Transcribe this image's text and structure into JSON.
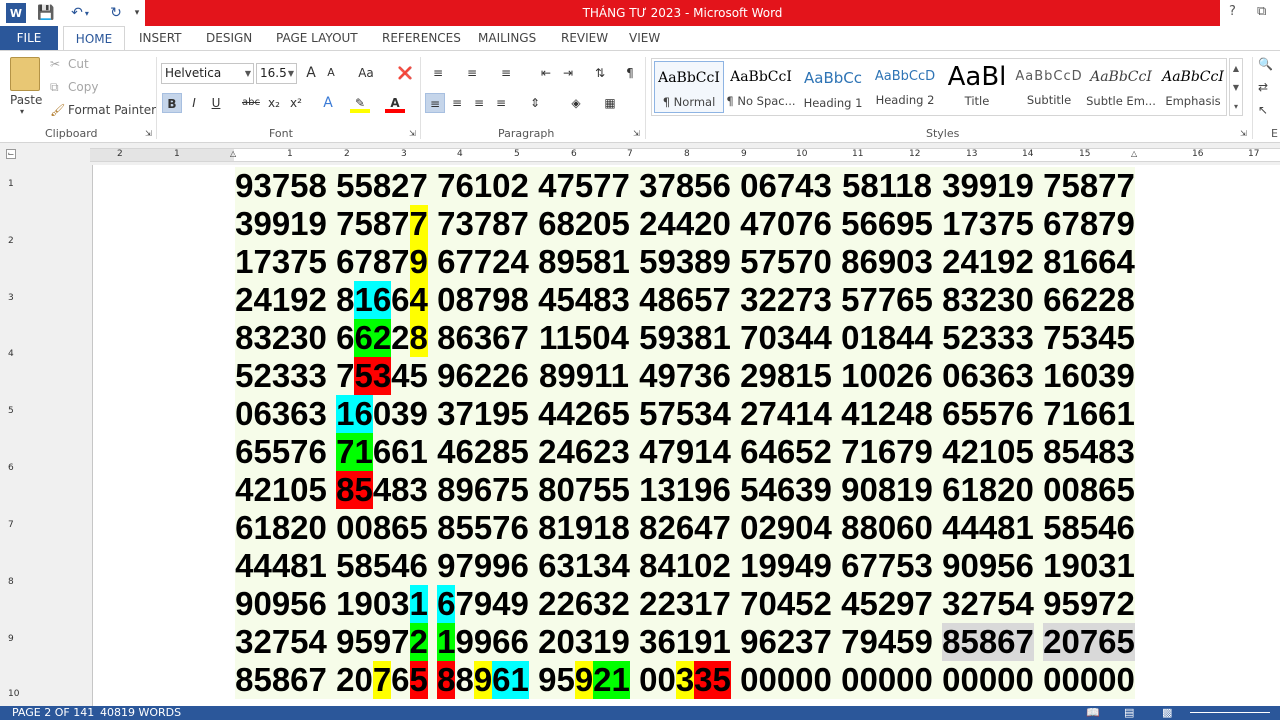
{
  "title": "THÁNG TƯ 2023 -  Microsoft Word",
  "titlebar_right": {
    "help": "?",
    "restore": "⧉"
  },
  "tabs": [
    "FILE",
    "HOME",
    "INSERT",
    "DESIGN",
    "PAGE LAYOUT",
    "REFERENCES",
    "MAILINGS",
    "REVIEW",
    "VIEW"
  ],
  "clipboard": {
    "paste": "Paste",
    "cut": "Cut",
    "copy": "Copy",
    "format_painter": "Format Painter",
    "label": "Clipboard"
  },
  "font": {
    "name": "Helvetica",
    "size": "16.5",
    "label": "Font",
    "grow": "A",
    "shrink": "A",
    "case": "Aa",
    "bold": "B",
    "italic": "I",
    "underline": "U",
    "strike": "abc",
    "sub": "x₂",
    "sup": "x²"
  },
  "paragraph": {
    "label": "Paragraph",
    "pilcrow": "¶"
  },
  "styles": {
    "label": "Styles",
    "items": [
      {
        "sample": "AaBbCcI",
        "name": "¶ Normal"
      },
      {
        "sample": "AaBbCcI",
        "name": "¶ No Spac..."
      },
      {
        "sample": "AaBbCc",
        "name": "Heading 1"
      },
      {
        "sample": "AaBbCcD",
        "name": "Heading 2"
      },
      {
        "sample": "AaBl",
        "name": "Title"
      },
      {
        "sample": "AaBbCcD",
        "name": "Subtitle"
      },
      {
        "sample": "AaBbCcI",
        "name": "Subtle Em..."
      },
      {
        "sample": "AaBbCcI",
        "name": "Emphasis"
      }
    ]
  },
  "editing_label": "E",
  "ruler_h": [
    "2",
    "1",
    "1",
    "2",
    "3",
    "4",
    "5",
    "6",
    "7",
    "8",
    "9",
    "10",
    "11",
    "12",
    "13",
    "14",
    "15",
    "16",
    "17",
    "18"
  ],
  "ruler_v": [
    "1",
    "2",
    "3",
    "4",
    "5",
    "6",
    "7",
    "8",
    "9",
    "10"
  ],
  "rows": [
    [
      "93758",
      "55827",
      "76102",
      "47577",
      "37856",
      "06743",
      "58118",
      "39919",
      "75877"
    ],
    [
      "39919",
      "75877",
      "73787",
      "68205",
      "24420",
      "47076",
      "56695",
      "17375",
      "67879"
    ],
    [
      "17375",
      "67879",
      "67724",
      "89581",
      "59389",
      "57570",
      "86903",
      "24192",
      "81664"
    ],
    [
      "24192",
      "81664",
      "08798",
      "45483",
      "48657",
      "32273",
      "57765",
      "83230",
      "66228"
    ],
    [
      "83230",
      "66228",
      "86367",
      "11504",
      "59381",
      "70344",
      "01844",
      "52333",
      "75345"
    ],
    [
      "52333",
      "75345",
      "96226",
      "89911",
      "49736",
      "29815",
      "10026",
      "06363",
      "16039"
    ],
    [
      "06363",
      "16039",
      "37195",
      "44265",
      "57534",
      "27414",
      "41248",
      "65576",
      "71661"
    ],
    [
      "65576",
      "71661",
      "46285",
      "24623",
      "47914",
      "64652",
      "71679",
      "42105",
      "85483"
    ],
    [
      "42105",
      "85483",
      "89675",
      "80755",
      "13196",
      "54639",
      "90819",
      "61820",
      "00865"
    ],
    [
      "61820",
      "00865",
      "85576",
      "81918",
      "82647",
      "02904",
      "88060",
      "44481",
      "58546"
    ],
    [
      "44481",
      "58546",
      "97996",
      "63134",
      "84102",
      "19949",
      "67753",
      "90956",
      "19031"
    ],
    [
      "90956",
      "19031",
      "67949",
      "22632",
      "22317",
      "70452",
      "45297",
      "32754",
      "95972"
    ],
    [
      "32754",
      "95972",
      "19966",
      "20319",
      "36191",
      "96237",
      "79459",
      "85867",
      "20765"
    ],
    [
      "85867",
      "20765",
      "88961",
      "95921",
      "00335",
      "00000",
      "00000",
      "00000",
      "00000"
    ]
  ],
  "colors": {
    "yellow": "#ffff00",
    "cyan": "#00ffff",
    "green": "#00ff00",
    "red": "#ff0000",
    "gray": "#d9d9d9",
    "row_bg": "#f6fce9",
    "accent": "#2b579a",
    "title_red": "#e3141b"
  },
  "highlights": [
    {
      "row": 1,
      "col": 1,
      "start": 4,
      "len": 1,
      "color": "yellow"
    },
    {
      "row": 2,
      "col": 1,
      "start": 4,
      "len": 1,
      "color": "yellow"
    },
    {
      "row": 3,
      "col": 1,
      "start": 1,
      "len": 2,
      "color": "cyan"
    },
    {
      "row": 3,
      "col": 1,
      "start": 4,
      "len": 1,
      "color": "yellow"
    },
    {
      "row": 4,
      "col": 1,
      "start": 1,
      "len": 2,
      "color": "green"
    },
    {
      "row": 4,
      "col": 1,
      "start": 4,
      "len": 1,
      "color": "yellow"
    },
    {
      "row": 5,
      "col": 1,
      "start": 1,
      "len": 2,
      "color": "red"
    },
    {
      "row": 6,
      "col": 1,
      "start": 0,
      "len": 2,
      "color": "cyan"
    },
    {
      "row": 7,
      "col": 1,
      "start": 0,
      "len": 2,
      "color": "green"
    },
    {
      "row": 8,
      "col": 1,
      "start": 0,
      "len": 2,
      "color": "red"
    },
    {
      "row": 11,
      "col": 1,
      "start": 4,
      "len": 1,
      "color": "cyan"
    },
    {
      "row": 11,
      "col": 2,
      "start": 0,
      "len": 1,
      "color": "cyan"
    },
    {
      "row": 12,
      "col": 1,
      "start": 4,
      "len": 1,
      "color": "green"
    },
    {
      "row": 12,
      "col": 2,
      "start": 0,
      "len": 1,
      "color": "green"
    },
    {
      "row": 12,
      "col": 7,
      "start": 0,
      "len": 5,
      "color": "gray"
    },
    {
      "row": 12,
      "col": 8,
      "start": 0,
      "len": 5,
      "color": "gray"
    },
    {
      "row": 13,
      "col": 1,
      "start": 2,
      "len": 1,
      "color": "yellow"
    },
    {
      "row": 13,
      "col": 1,
      "start": 4,
      "len": 1,
      "color": "red"
    },
    {
      "row": 13,
      "col": 2,
      "start": 0,
      "len": 1,
      "color": "red"
    },
    {
      "row": 13,
      "col": 2,
      "start": 2,
      "len": 1,
      "color": "yellow"
    },
    {
      "row": 13,
      "col": 2,
      "start": 3,
      "len": 2,
      "color": "cyan"
    },
    {
      "row": 13,
      "col": 3,
      "start": 2,
      "len": 1,
      "color": "yellow"
    },
    {
      "row": 13,
      "col": 3,
      "start": 3,
      "len": 2,
      "color": "green"
    },
    {
      "row": 13,
      "col": 4,
      "start": 2,
      "len": 1,
      "color": "yellow"
    },
    {
      "row": 13,
      "col": 4,
      "start": 3,
      "len": 2,
      "color": "red"
    }
  ],
  "status": {
    "page": "PAGE 2 OF 141",
    "words": "40819 WORDS"
  }
}
